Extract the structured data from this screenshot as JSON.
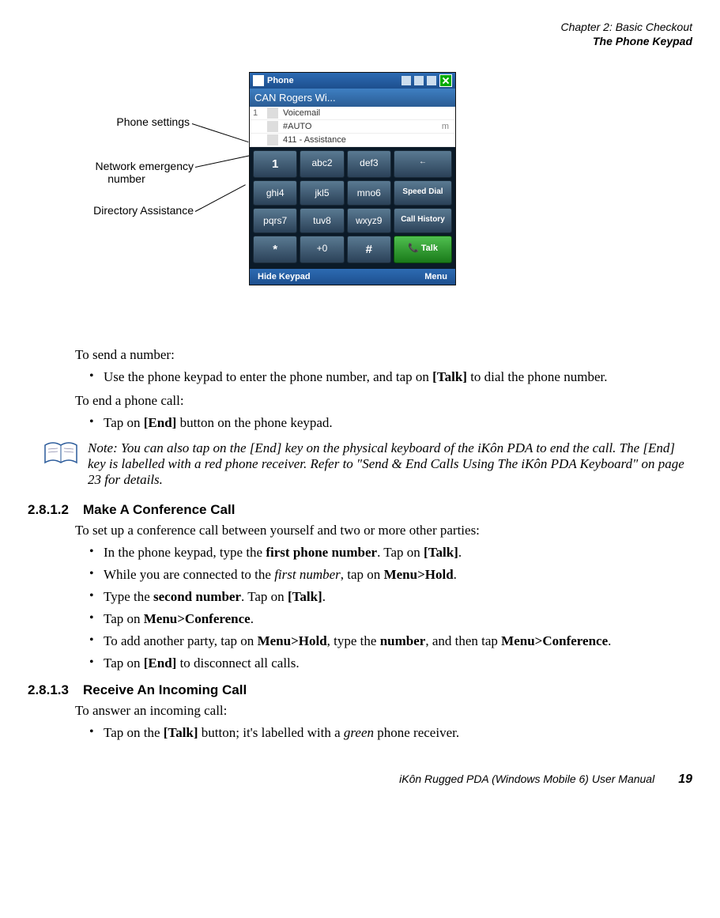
{
  "header": {
    "chapter": "Chapter 2: Basic Checkout",
    "section": "The Phone Keypad"
  },
  "callouts": {
    "phone_settings": "Phone settings",
    "network_emergency_l1": "Network emergency",
    "network_emergency_l2": "number",
    "directory_assistance": "Directory Assistance"
  },
  "phone": {
    "title": "Phone",
    "carrier": "CAN Rogers Wi...",
    "list": {
      "row1_num": "1",
      "row1_label": "Voicemail",
      "row2_label": "#AUTO",
      "row2_right": "m",
      "row3_label": "411 - Assistance"
    },
    "keys": {
      "k1": "1",
      "k2": "abc2",
      "k3": "def3",
      "k4": "ghi4",
      "k5": "jkl5",
      "k6": "mno6",
      "k7": "pqrs7",
      "k8": "tuv8",
      "k9": "wxyz9",
      "kstar": "*",
      "k0": "+0",
      "khash": "#",
      "back": "←",
      "speed": "Speed Dial",
      "history": "Call History",
      "talk": "Talk"
    },
    "soft_left": "Hide Keypad",
    "soft_right": "Menu"
  },
  "body": {
    "send_intro": "To send a number:",
    "send_b1_pre": "Use the phone keypad to enter the phone number, and tap on ",
    "send_b1_bold": "[Talk]",
    "send_b1_post": " to dial the phone number.",
    "end_intro": "To end a phone call:",
    "end_b1_pre": "Tap on ",
    "end_b1_bold": "[End]",
    "end_b1_post": " button on the phone keypad.",
    "note_label": "Note:",
    "note_text": " You can also tap on the [End] key on the physical keyboard of the iKôn PDA to end the call. The [End] key is labelled with a red phone receiver. Refer to \"Send & End Calls Using The iKôn PDA Keyboard\" on page 23 for details."
  },
  "s2": {
    "num": "2.8.1.2",
    "title": "Make A Conference Call",
    "intro": "To set up a conference call between yourself and two or more other parties:",
    "b1_a": "In the phone keypad, type the ",
    "b1_bold1": "first phone number",
    "b1_b": ". Tap on ",
    "b1_bold2": "[Talk]",
    "b1_c": ".",
    "b2_a": "While you are connected to the ",
    "b2_it": "first number",
    "b2_b": ", tap on ",
    "b2_bold": "Menu>Hold",
    "b2_c": ".",
    "b3_a": "Type the ",
    "b3_bold1": "second number",
    "b3_b": ". Tap on ",
    "b3_bold2": "[Talk]",
    "b3_c": ".",
    "b4_a": "Tap on ",
    "b4_bold": "Menu>Conference",
    "b4_b": ".",
    "b5_a": "To add another party, tap on ",
    "b5_bold1": "Menu>Hold",
    "b5_b": ", type the ",
    "b5_bold2": "number",
    "b5_c": ", and then tap ",
    "b5_bold3": "Menu>Conference",
    "b5_d": ".",
    "b6_a": "Tap on ",
    "b6_bold": "[End]",
    "b6_b": " to disconnect all calls."
  },
  "s3": {
    "num": "2.8.1.3",
    "title": "Receive An Incoming Call",
    "intro": "To answer an incoming call:",
    "b1_a": "Tap on the ",
    "b1_bold": "[Talk]",
    "b1_b": " button; it's labelled with a ",
    "b1_it": "green",
    "b1_c": " phone receiver."
  },
  "footer": {
    "title": "iKôn Rugged PDA (Windows Mobile 6) User Manual",
    "page": "19"
  }
}
